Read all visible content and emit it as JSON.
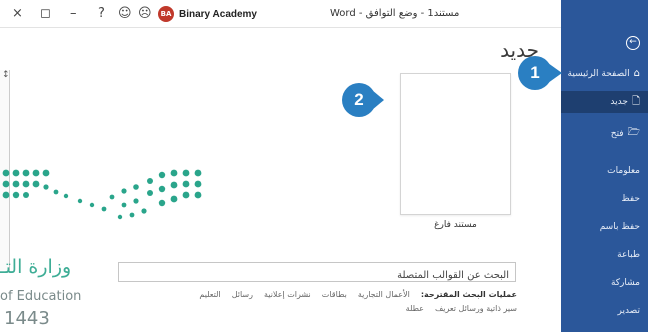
{
  "titlebar": {
    "close_glyph": "×",
    "restore_glyph": "◻",
    "minimize_glyph": "–",
    "help_glyph": "?",
    "smile_glyph": "☺",
    "frown_glyph": "☹",
    "avatar_initials": "BA",
    "user_name": "Binary Academy",
    "document_title": "Word  -  مستند1 - وضع التوافق"
  },
  "sidebar": {
    "back_glyph": "←",
    "items": [
      {
        "label": "الصفحة الرئيسية",
        "icon": "home-icon",
        "glyph": "⌂"
      },
      {
        "label": "جديد",
        "icon": "new-document-icon",
        "glyph": "🗋"
      },
      {
        "label": "فتح",
        "icon": "open-folder-icon",
        "glyph": "🗁"
      },
      {
        "label": "معلومات"
      },
      {
        "label": "حفظ"
      },
      {
        "label": "حفظ باسم"
      },
      {
        "label": "طباعة"
      },
      {
        "label": "مشاركة"
      },
      {
        "label": "تصدير"
      }
    ],
    "active_index": 1,
    "color": "#2b579a"
  },
  "main": {
    "title": "جديد",
    "left_marker": "↕",
    "blank_document_label": "مستند فارغ",
    "search_placeholder": "البحث عن القوالب المتصلة",
    "suggested_label": "عمليات البحث المقترحة:",
    "suggested_links": [
      "الأعمال التجارية",
      "بطاقات",
      "نشرات إعلانية",
      "رسائل",
      "التعليم"
    ],
    "suggested_links_row2": [
      "سير ذاتية ورسائل تعريف",
      "عطلة"
    ]
  },
  "callouts": {
    "one": "1",
    "two": "2",
    "color": "#2a7fc2"
  },
  "watermark": {
    "arabic": "وزارة التـ",
    "english": "of Education",
    "year": "1443",
    "color": "#2aa58b"
  }
}
